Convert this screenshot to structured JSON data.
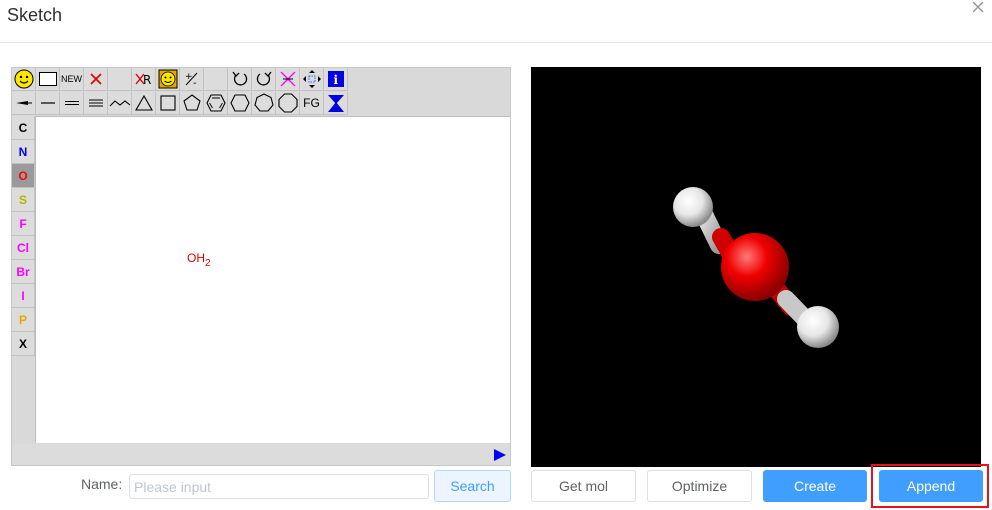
{
  "dialog": {
    "title": "Sketch",
    "close_icon": "close-icon"
  },
  "editor": {
    "toolbar_row1": [
      {
        "name": "smiley-icon",
        "label": ""
      },
      {
        "name": "select-rectangle-icon",
        "label": ""
      },
      {
        "name": "new-button",
        "label": "NEW"
      },
      {
        "name": "delete-icon",
        "label": ""
      },
      {
        "name": "blank-slot",
        "label": ""
      },
      {
        "name": "delete-r-group-icon",
        "label": ""
      },
      {
        "name": "smiley-badge-icon",
        "label": ""
      },
      {
        "name": "charge-icon",
        "label": ""
      },
      {
        "name": "blank-slot-2",
        "label": ""
      },
      {
        "name": "undo-icon",
        "label": ""
      },
      {
        "name": "redo-icon",
        "label": ""
      },
      {
        "name": "clear-icon",
        "label": ""
      },
      {
        "name": "move-icon",
        "label": ""
      },
      {
        "name": "info-icon",
        "label": ""
      }
    ],
    "toolbar_row2": [
      {
        "name": "wedge-bond-icon",
        "label": ""
      },
      {
        "name": "single-bond-icon",
        "label": ""
      },
      {
        "name": "double-bond-icon",
        "label": ""
      },
      {
        "name": "triple-bond-icon",
        "label": ""
      },
      {
        "name": "chain-icon",
        "label": ""
      },
      {
        "name": "triangle-ring-icon",
        "label": ""
      },
      {
        "name": "square-ring-icon",
        "label": ""
      },
      {
        "name": "pentagon-ring-icon",
        "label": ""
      },
      {
        "name": "benzene-ring-icon",
        "label": ""
      },
      {
        "name": "hexagon-ring-icon",
        "label": ""
      },
      {
        "name": "heptagon-ring-icon",
        "label": ""
      },
      {
        "name": "octagon-ring-icon",
        "label": ""
      },
      {
        "name": "fg-button",
        "label": "FG"
      },
      {
        "name": "template-icon",
        "label": ""
      }
    ],
    "atoms": [
      {
        "symbol": "C",
        "color": "#000000",
        "active": false
      },
      {
        "symbol": "N",
        "color": "#0000ff",
        "active": false
      },
      {
        "symbol": "O",
        "color": "#ff0000",
        "active": true
      },
      {
        "symbol": "S",
        "color": "#b5b500",
        "active": false
      },
      {
        "symbol": "F",
        "color": "#ff00ff",
        "active": false
      },
      {
        "symbol": "Cl",
        "color": "#ff00ff",
        "active": false
      },
      {
        "symbol": "Br",
        "color": "#ff00ff",
        "active": false
      },
      {
        "symbol": "I",
        "color": "#ff00ff",
        "active": false
      },
      {
        "symbol": "P",
        "color": "#e6a800",
        "active": false
      },
      {
        "symbol": "X",
        "color": "#000000",
        "active": false
      }
    ],
    "molecule": {
      "main": "OH",
      "subscript": "2"
    }
  },
  "name_row": {
    "label": "Name:",
    "placeholder": "Please input",
    "value": "",
    "search_label": "Search"
  },
  "viewer_buttons": {
    "get_mol": "Get mol",
    "optimize": "Optimize",
    "create": "Create",
    "append": "Append"
  },
  "colors": {
    "primary": "#409eff",
    "highlight": "#e8121a",
    "oxygen": "#e00000"
  }
}
